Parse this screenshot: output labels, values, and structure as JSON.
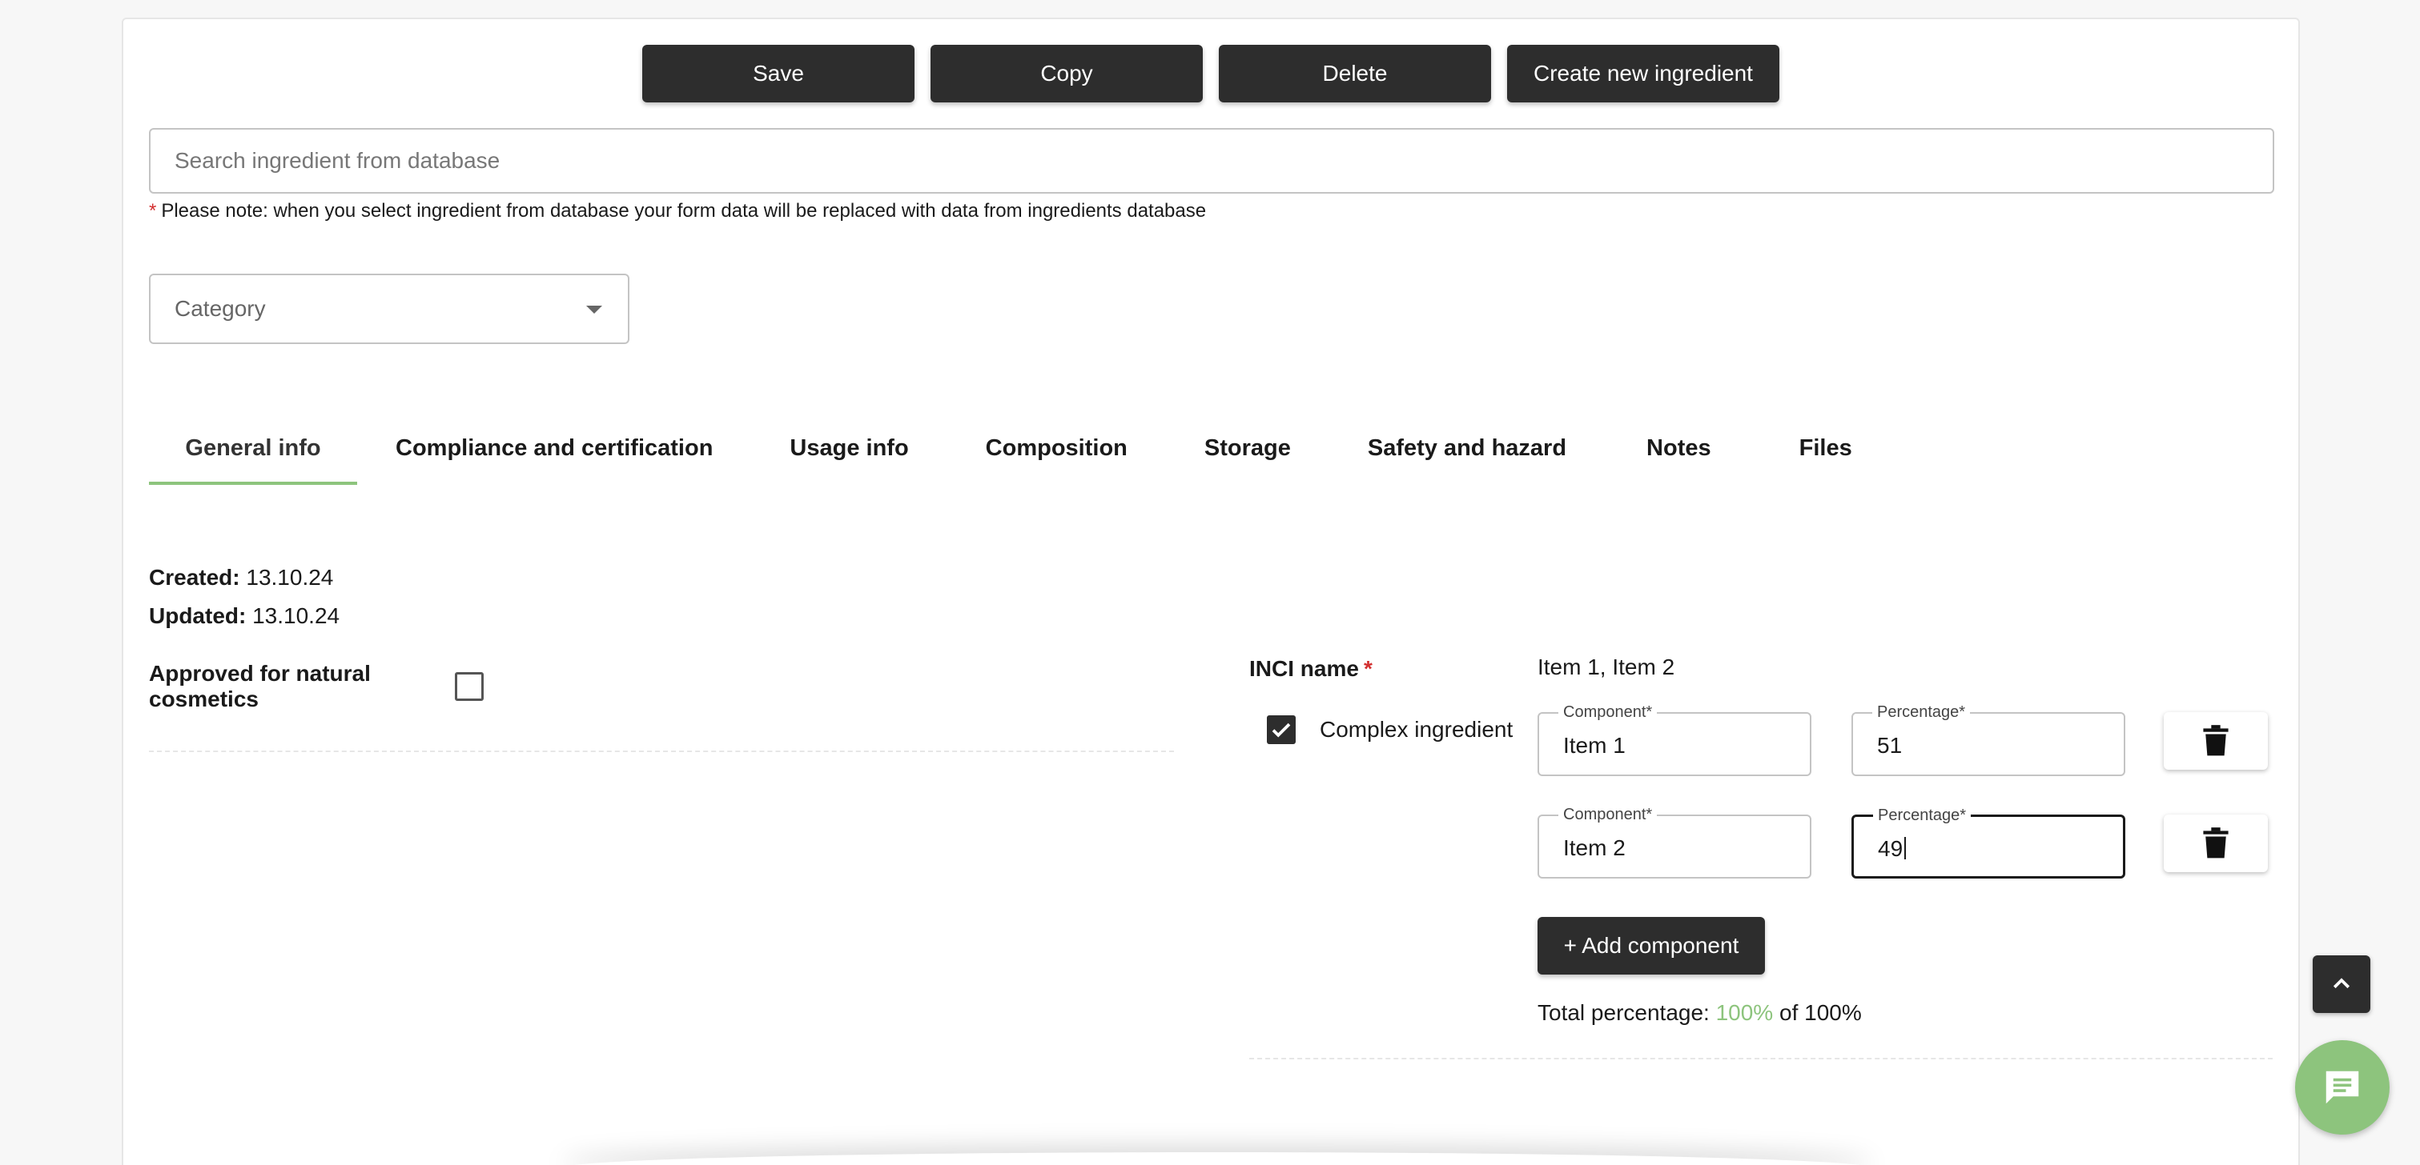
{
  "toolbar": {
    "save_label": "Save",
    "copy_label": "Copy",
    "delete_label": "Delete",
    "create_label": "Create new ingredient"
  },
  "search": {
    "placeholder": "Search ingredient from database",
    "note_star": "*",
    "note": "Please note: when you select ingredient from database your form data will be replaced with data from ingredients database"
  },
  "category": {
    "placeholder": "Category"
  },
  "tabs": [
    {
      "label": "General info"
    },
    {
      "label": "Compliance and certification"
    },
    {
      "label": "Usage info"
    },
    {
      "label": "Composition"
    },
    {
      "label": "Storage"
    },
    {
      "label": "Safety and hazard"
    },
    {
      "label": "Notes"
    },
    {
      "label": "Files"
    }
  ],
  "meta": {
    "created_label": "Created:",
    "created_value": "13.10.24",
    "updated_label": "Updated:",
    "updated_value": "13.10.24"
  },
  "approved": {
    "label": "Approved for natural cosmetics",
    "checked": false
  },
  "inci": {
    "label": "INCI name",
    "required_star": "*",
    "value": "Item 1, Item 2",
    "complex_label": "Complex ingredient",
    "complex_checked": true,
    "components": [
      {
        "component_legend": "Component*",
        "component_value": "Item 1",
        "percentage_legend": "Percentage*",
        "percentage_value": "51"
      },
      {
        "component_legend": "Component*",
        "component_value": "Item 2",
        "percentage_legend": "Percentage*",
        "percentage_value": "49"
      }
    ],
    "add_label": "+ Add component",
    "total_label": "Total percentage:",
    "total_value": "100%",
    "total_of": "of 100%"
  },
  "colors": {
    "accent": "#8dc47d",
    "dark_button": "#2d2d2d",
    "required": "#d32f2f"
  },
  "icons": {
    "dropdown": "chevron-down-icon",
    "trash": "trash-icon",
    "scroll_top": "chevron-up-icon",
    "chat": "chat-icon",
    "check": "check-icon"
  }
}
